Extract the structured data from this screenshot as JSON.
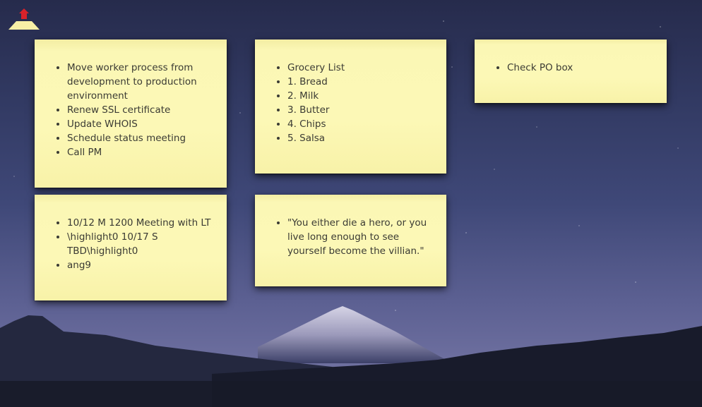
{
  "app": {
    "logo_icon": "sticky-note-upload-icon"
  },
  "notes": [
    {
      "items": [
        "Move worker process from development to production environment",
        "Renew SSL certificate",
        "Update WHOIS",
        "Schedule status meeting",
        "Call PM"
      ]
    },
    {
      "items": [
        "Grocery List",
        "1. Bread",
        "2. Milk",
        "3. Butter",
        "4. Chips",
        "5. Salsa"
      ]
    },
    {
      "items": [
        "Check PO box"
      ]
    },
    {
      "items": [
        "10/12 M 1200 Meeting with LT",
        "\\highlight0 10/17 S TBD\\highlight0",
        "ang9"
      ]
    },
    {
      "items": [
        "\"You either die a hero, or you live long enough to see yourself become the villian.\""
      ]
    }
  ],
  "colors": {
    "note_background": "#fcf8b6",
    "note_text": "#3b3b34",
    "logo_arrow": "#d9222a",
    "logo_base": "#f8f0a6"
  }
}
